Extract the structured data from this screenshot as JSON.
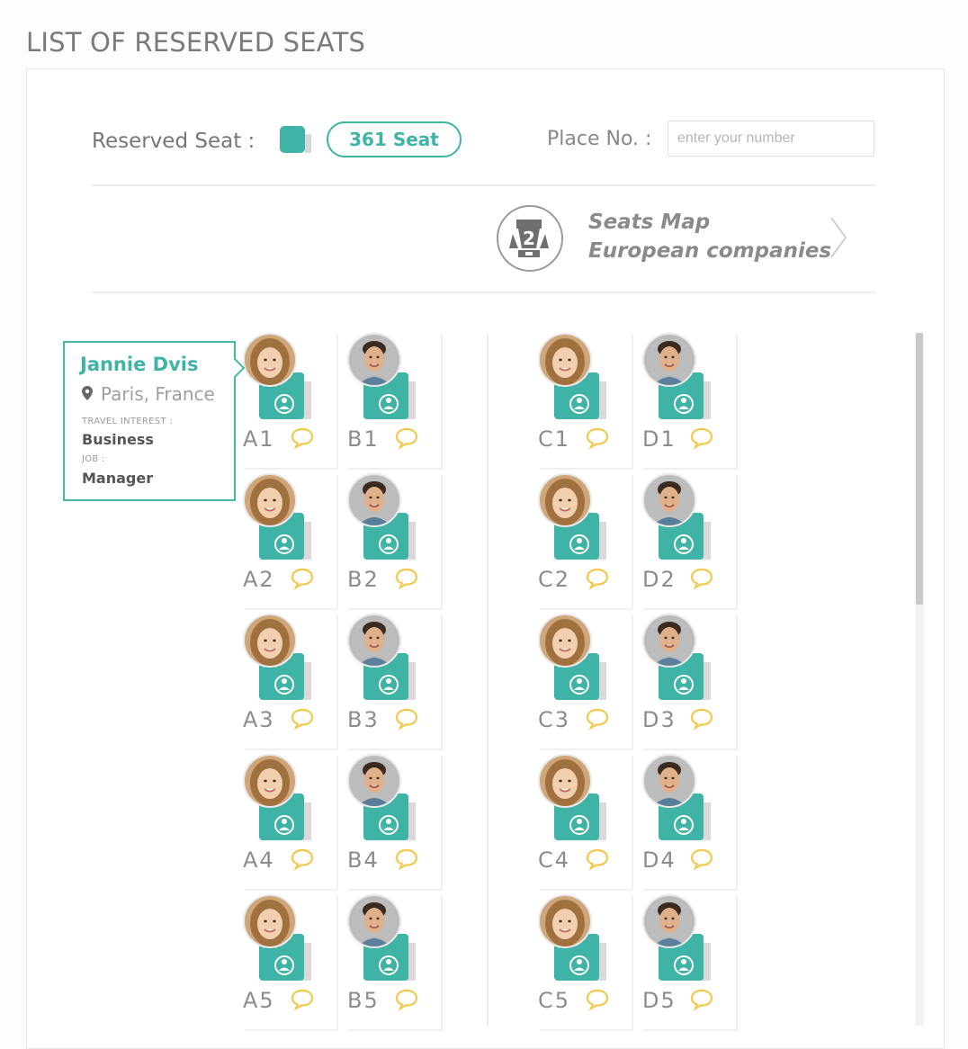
{
  "page": {
    "title": "LIST OF RESERVED SEATS"
  },
  "toolbar": {
    "reserved_label": "Reserved Seat :",
    "seat_count": "361 Seat",
    "place_label": "Place No. :",
    "place_placeholder": "enter your number",
    "place_value": ""
  },
  "seats_map_link": {
    "icon": "seat-map-badge-icon",
    "title": "Seats Map",
    "subtitle": "European companies"
  },
  "tooltip": {
    "name": "Jannie Dvis",
    "location": "Paris, France",
    "travel_interest_label": "TRAVEL INTEREST :",
    "travel_interest": "Business",
    "job_label": "JOB :",
    "job": "Manager"
  },
  "colors": {
    "accent": "#3fb3a5",
    "chat_icon": "#f2c94c",
    "text_muted": "#8c8c8c"
  },
  "seats": [
    {
      "label": "A1",
      "avatar": "woman"
    },
    {
      "label": "B1",
      "avatar": "man"
    },
    {
      "label": "C1",
      "avatar": "woman"
    },
    {
      "label": "D1",
      "avatar": "man"
    },
    {
      "label": "A2",
      "avatar": "woman"
    },
    {
      "label": "B2",
      "avatar": "man"
    },
    {
      "label": "C2",
      "avatar": "woman"
    },
    {
      "label": "D2",
      "avatar": "man"
    },
    {
      "label": "A3",
      "avatar": "woman"
    },
    {
      "label": "B3",
      "avatar": "man"
    },
    {
      "label": "C3",
      "avatar": "woman"
    },
    {
      "label": "D3",
      "avatar": "man"
    },
    {
      "label": "A4",
      "avatar": "woman"
    },
    {
      "label": "B4",
      "avatar": "man"
    },
    {
      "label": "C4",
      "avatar": "woman"
    },
    {
      "label": "D4",
      "avatar": "man"
    },
    {
      "label": "A5",
      "avatar": "woman"
    },
    {
      "label": "B5",
      "avatar": "man"
    },
    {
      "label": "C5",
      "avatar": "woman"
    },
    {
      "label": "D5",
      "avatar": "man"
    }
  ]
}
